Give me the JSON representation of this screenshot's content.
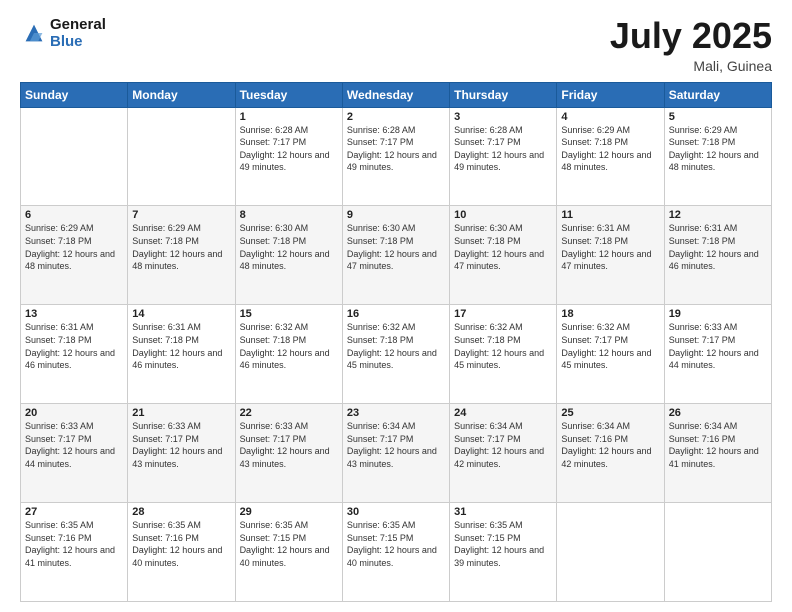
{
  "header": {
    "logo_line1": "General",
    "logo_line2": "Blue",
    "month": "July 2025",
    "location": "Mali, Guinea"
  },
  "days_of_week": [
    "Sunday",
    "Monday",
    "Tuesday",
    "Wednesday",
    "Thursday",
    "Friday",
    "Saturday"
  ],
  "weeks": [
    [
      {
        "day": "",
        "info": ""
      },
      {
        "day": "",
        "info": ""
      },
      {
        "day": "1",
        "info": "Sunrise: 6:28 AM\nSunset: 7:17 PM\nDaylight: 12 hours and 49 minutes."
      },
      {
        "day": "2",
        "info": "Sunrise: 6:28 AM\nSunset: 7:17 PM\nDaylight: 12 hours and 49 minutes."
      },
      {
        "day": "3",
        "info": "Sunrise: 6:28 AM\nSunset: 7:17 PM\nDaylight: 12 hours and 49 minutes."
      },
      {
        "day": "4",
        "info": "Sunrise: 6:29 AM\nSunset: 7:18 PM\nDaylight: 12 hours and 48 minutes."
      },
      {
        "day": "5",
        "info": "Sunrise: 6:29 AM\nSunset: 7:18 PM\nDaylight: 12 hours and 48 minutes."
      }
    ],
    [
      {
        "day": "6",
        "info": "Sunrise: 6:29 AM\nSunset: 7:18 PM\nDaylight: 12 hours and 48 minutes."
      },
      {
        "day": "7",
        "info": "Sunrise: 6:29 AM\nSunset: 7:18 PM\nDaylight: 12 hours and 48 minutes."
      },
      {
        "day": "8",
        "info": "Sunrise: 6:30 AM\nSunset: 7:18 PM\nDaylight: 12 hours and 48 minutes."
      },
      {
        "day": "9",
        "info": "Sunrise: 6:30 AM\nSunset: 7:18 PM\nDaylight: 12 hours and 47 minutes."
      },
      {
        "day": "10",
        "info": "Sunrise: 6:30 AM\nSunset: 7:18 PM\nDaylight: 12 hours and 47 minutes."
      },
      {
        "day": "11",
        "info": "Sunrise: 6:31 AM\nSunset: 7:18 PM\nDaylight: 12 hours and 47 minutes."
      },
      {
        "day": "12",
        "info": "Sunrise: 6:31 AM\nSunset: 7:18 PM\nDaylight: 12 hours and 46 minutes."
      }
    ],
    [
      {
        "day": "13",
        "info": "Sunrise: 6:31 AM\nSunset: 7:18 PM\nDaylight: 12 hours and 46 minutes."
      },
      {
        "day": "14",
        "info": "Sunrise: 6:31 AM\nSunset: 7:18 PM\nDaylight: 12 hours and 46 minutes."
      },
      {
        "day": "15",
        "info": "Sunrise: 6:32 AM\nSunset: 7:18 PM\nDaylight: 12 hours and 46 minutes."
      },
      {
        "day": "16",
        "info": "Sunrise: 6:32 AM\nSunset: 7:18 PM\nDaylight: 12 hours and 45 minutes."
      },
      {
        "day": "17",
        "info": "Sunrise: 6:32 AM\nSunset: 7:18 PM\nDaylight: 12 hours and 45 minutes."
      },
      {
        "day": "18",
        "info": "Sunrise: 6:32 AM\nSunset: 7:17 PM\nDaylight: 12 hours and 45 minutes."
      },
      {
        "day": "19",
        "info": "Sunrise: 6:33 AM\nSunset: 7:17 PM\nDaylight: 12 hours and 44 minutes."
      }
    ],
    [
      {
        "day": "20",
        "info": "Sunrise: 6:33 AM\nSunset: 7:17 PM\nDaylight: 12 hours and 44 minutes."
      },
      {
        "day": "21",
        "info": "Sunrise: 6:33 AM\nSunset: 7:17 PM\nDaylight: 12 hours and 43 minutes."
      },
      {
        "day": "22",
        "info": "Sunrise: 6:33 AM\nSunset: 7:17 PM\nDaylight: 12 hours and 43 minutes."
      },
      {
        "day": "23",
        "info": "Sunrise: 6:34 AM\nSunset: 7:17 PM\nDaylight: 12 hours and 43 minutes."
      },
      {
        "day": "24",
        "info": "Sunrise: 6:34 AM\nSunset: 7:17 PM\nDaylight: 12 hours and 42 minutes."
      },
      {
        "day": "25",
        "info": "Sunrise: 6:34 AM\nSunset: 7:16 PM\nDaylight: 12 hours and 42 minutes."
      },
      {
        "day": "26",
        "info": "Sunrise: 6:34 AM\nSunset: 7:16 PM\nDaylight: 12 hours and 41 minutes."
      }
    ],
    [
      {
        "day": "27",
        "info": "Sunrise: 6:35 AM\nSunset: 7:16 PM\nDaylight: 12 hours and 41 minutes."
      },
      {
        "day": "28",
        "info": "Sunrise: 6:35 AM\nSunset: 7:16 PM\nDaylight: 12 hours and 40 minutes."
      },
      {
        "day": "29",
        "info": "Sunrise: 6:35 AM\nSunset: 7:15 PM\nDaylight: 12 hours and 40 minutes."
      },
      {
        "day": "30",
        "info": "Sunrise: 6:35 AM\nSunset: 7:15 PM\nDaylight: 12 hours and 40 minutes."
      },
      {
        "day": "31",
        "info": "Sunrise: 6:35 AM\nSunset: 7:15 PM\nDaylight: 12 hours and 39 minutes."
      },
      {
        "day": "",
        "info": ""
      },
      {
        "day": "",
        "info": ""
      }
    ]
  ]
}
